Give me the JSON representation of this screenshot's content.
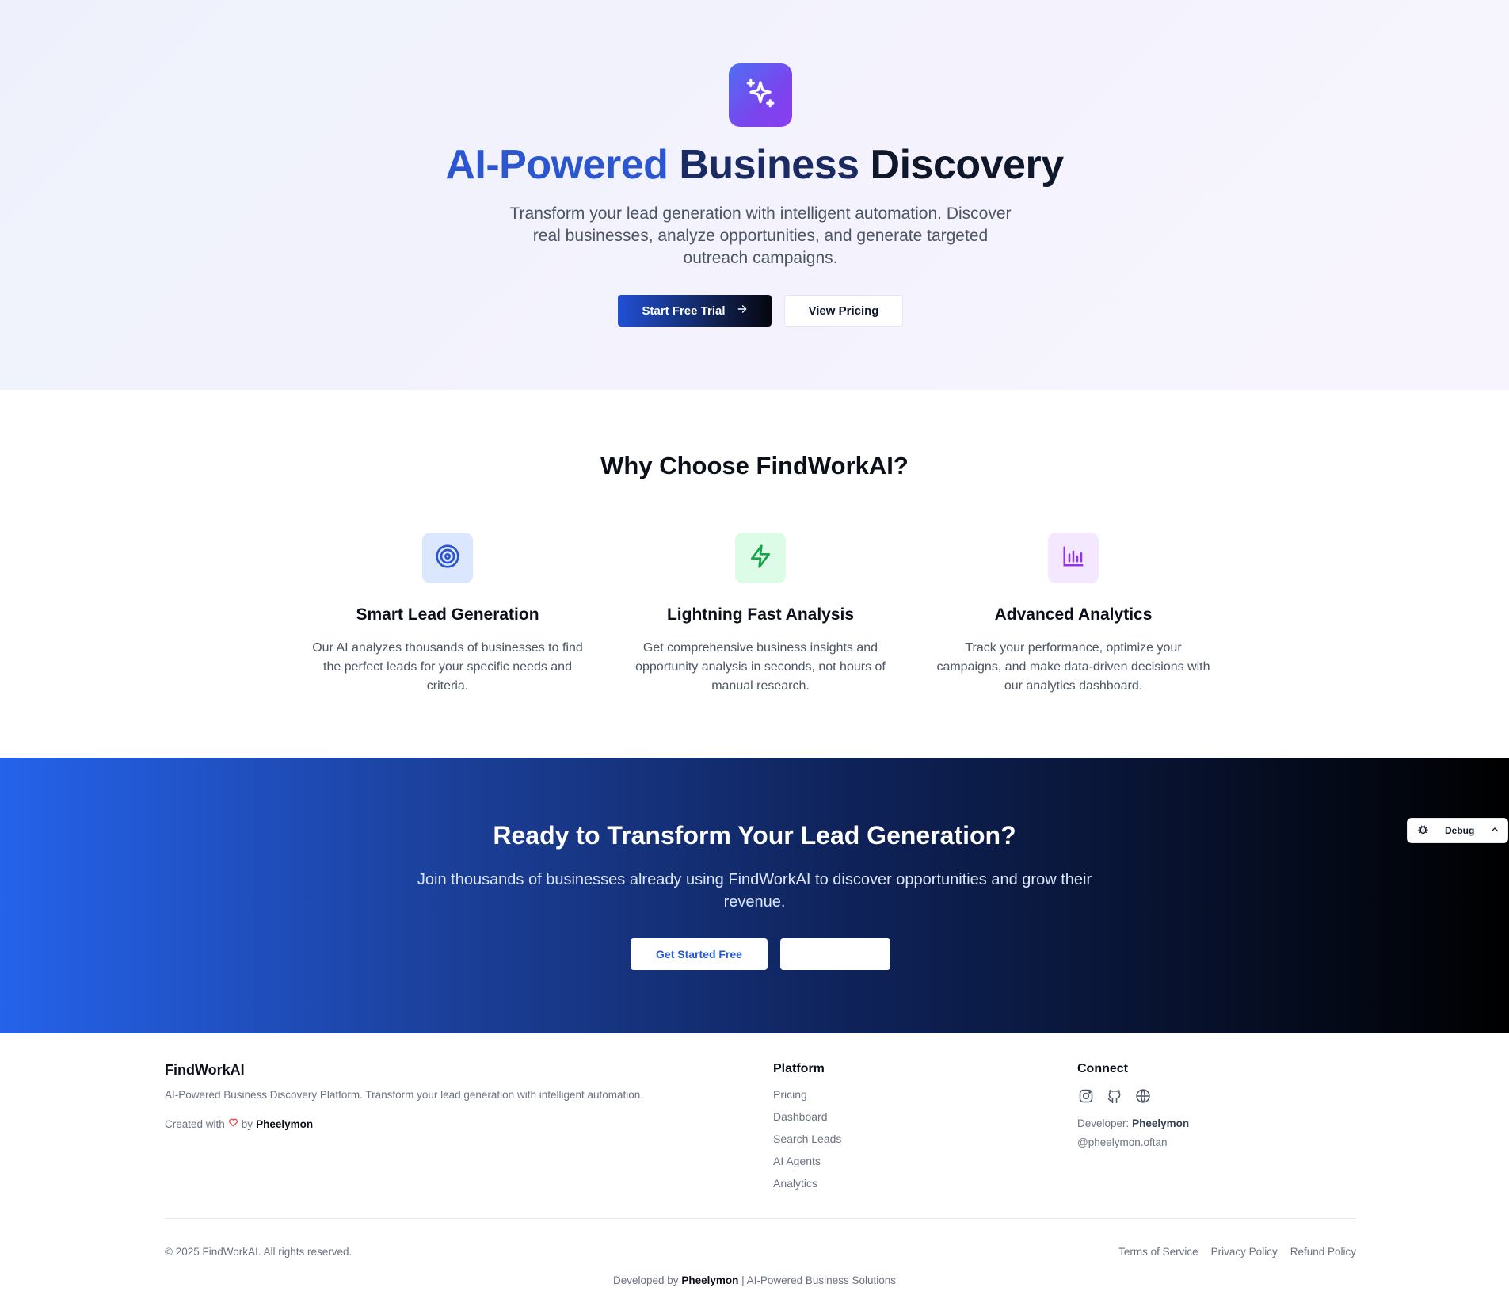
{
  "hero": {
    "title_part1": "AI-Powered",
    "title_part2": "Business",
    "title_part3": "Discovery",
    "subtitle": "Transform your lead generation with intelligent automation. Discover real businesses, analyze opportunities, and generate targeted outreach campaigns.",
    "primary_button": "Start Free Trial",
    "secondary_button": "View Pricing",
    "badge_icon": "sparkles-icon"
  },
  "features": {
    "title": "Why Choose FindWorkAI?",
    "items": [
      {
        "title": "Smart Lead Generation",
        "description": "Our AI analyzes thousands of businesses to find the perfect leads for your specific needs and criteria.",
        "icon": "target-icon",
        "color": "#2b56cf"
      },
      {
        "title": "Lightning Fast Analysis",
        "description": "Get comprehensive business insights and opportunity analysis in seconds, not hours of manual research.",
        "icon": "lightning-icon",
        "color": "#16a34a"
      },
      {
        "title": "Advanced Analytics",
        "description": "Track your performance, optimize your campaigns, and make data-driven decisions with our analytics dashboard.",
        "icon": "bar-chart-icon",
        "color": "#9333ea"
      }
    ]
  },
  "cta": {
    "title": "Ready to Transform Your Lead Generation?",
    "subtitle": "Join thousands of businesses already using FindWorkAI to discover opportunities and grow their revenue.",
    "primary_button": "Get Started Free",
    "secondary_button": ""
  },
  "debug": {
    "label": "Debug"
  },
  "footer": {
    "brand": "FindWorkAI",
    "description": "AI-Powered Business Discovery Platform. Transform your lead generation with intelligent automation.",
    "created_prefix": "Created with",
    "created_by": "by",
    "author": "Pheelymon",
    "platform_title": "Platform",
    "platform_links": [
      "Pricing",
      "Dashboard",
      "Search Leads",
      "AI Agents",
      "Analytics"
    ],
    "connect_title": "Connect",
    "socials": [
      "instagram-icon",
      "github-icon",
      "globe-icon"
    ],
    "developer_label": "Developer:",
    "developer_name": "Pheelymon",
    "handle": "@pheelymon.oftan",
    "copyright": "© 2025 FindWorkAI. All rights reserved.",
    "legal_links": [
      "Terms of Service",
      "Privacy Policy",
      "Refund Policy"
    ],
    "developed_prefix": "Developed by",
    "developed_name": "Pheelymon",
    "developed_suffix": "| AI-Powered Business Solutions"
  },
  "colors": {
    "accent_blue": "#2b56cf",
    "brand_purple": "#7a45ee",
    "cta_gradient_start": "#2563eb",
    "cta_gradient_end": "#000000"
  }
}
